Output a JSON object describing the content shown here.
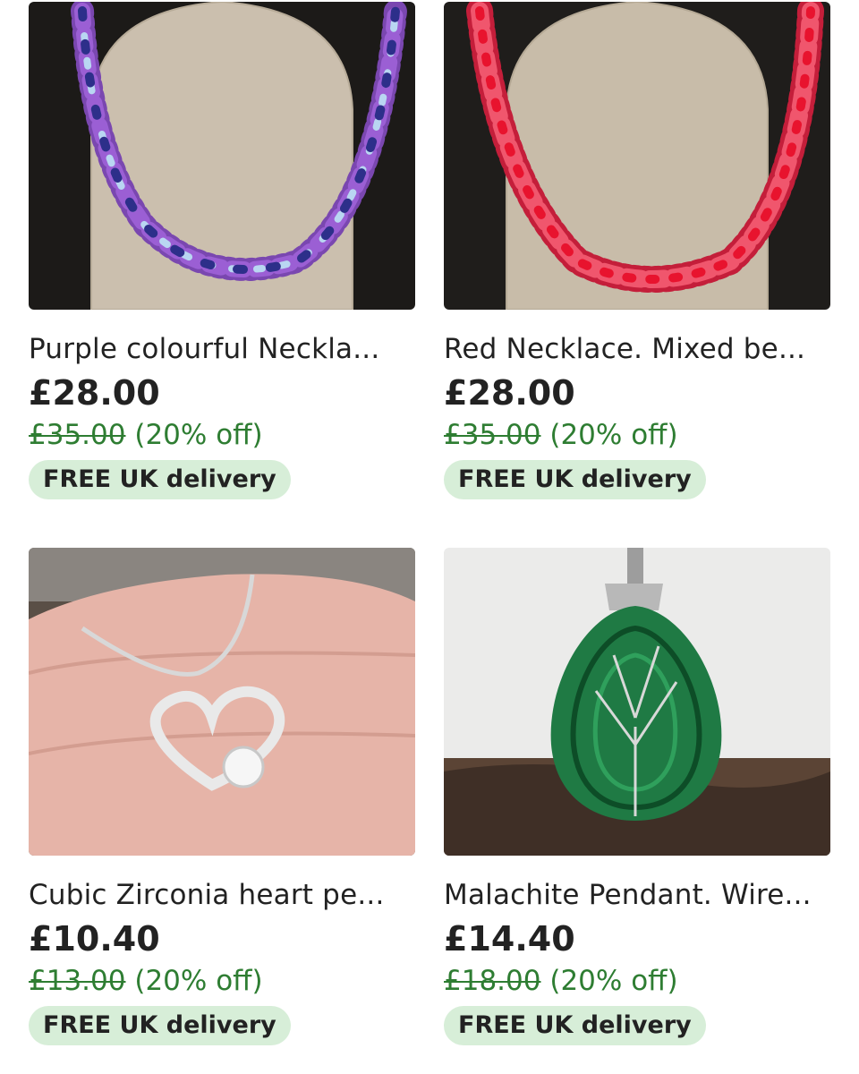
{
  "listings": [
    {
      "title": "Purple colourful Neckla...",
      "price": "£28.00",
      "original_price": "£35.00",
      "discount": "(20% off)",
      "delivery_badge": "FREE UK delivery"
    },
    {
      "title": "Red Necklace. Mixed be...",
      "price": "£28.00",
      "original_price": "£35.00",
      "discount": "(20% off)",
      "delivery_badge": "FREE UK delivery"
    },
    {
      "title": "Cubic Zirconia heart pe...",
      "price": "£10.40",
      "original_price": "£13.00",
      "discount": "(20% off)",
      "delivery_badge": "FREE UK delivery"
    },
    {
      "title": "Malachite Pendant. Wire...",
      "price": "£14.40",
      "original_price": "£18.00",
      "discount": "(20% off)",
      "delivery_badge": "FREE UK delivery"
    }
  ],
  "colors": {
    "discount_green": "#2e7d32",
    "badge_background": "#d7eed8",
    "text": "#222222"
  }
}
